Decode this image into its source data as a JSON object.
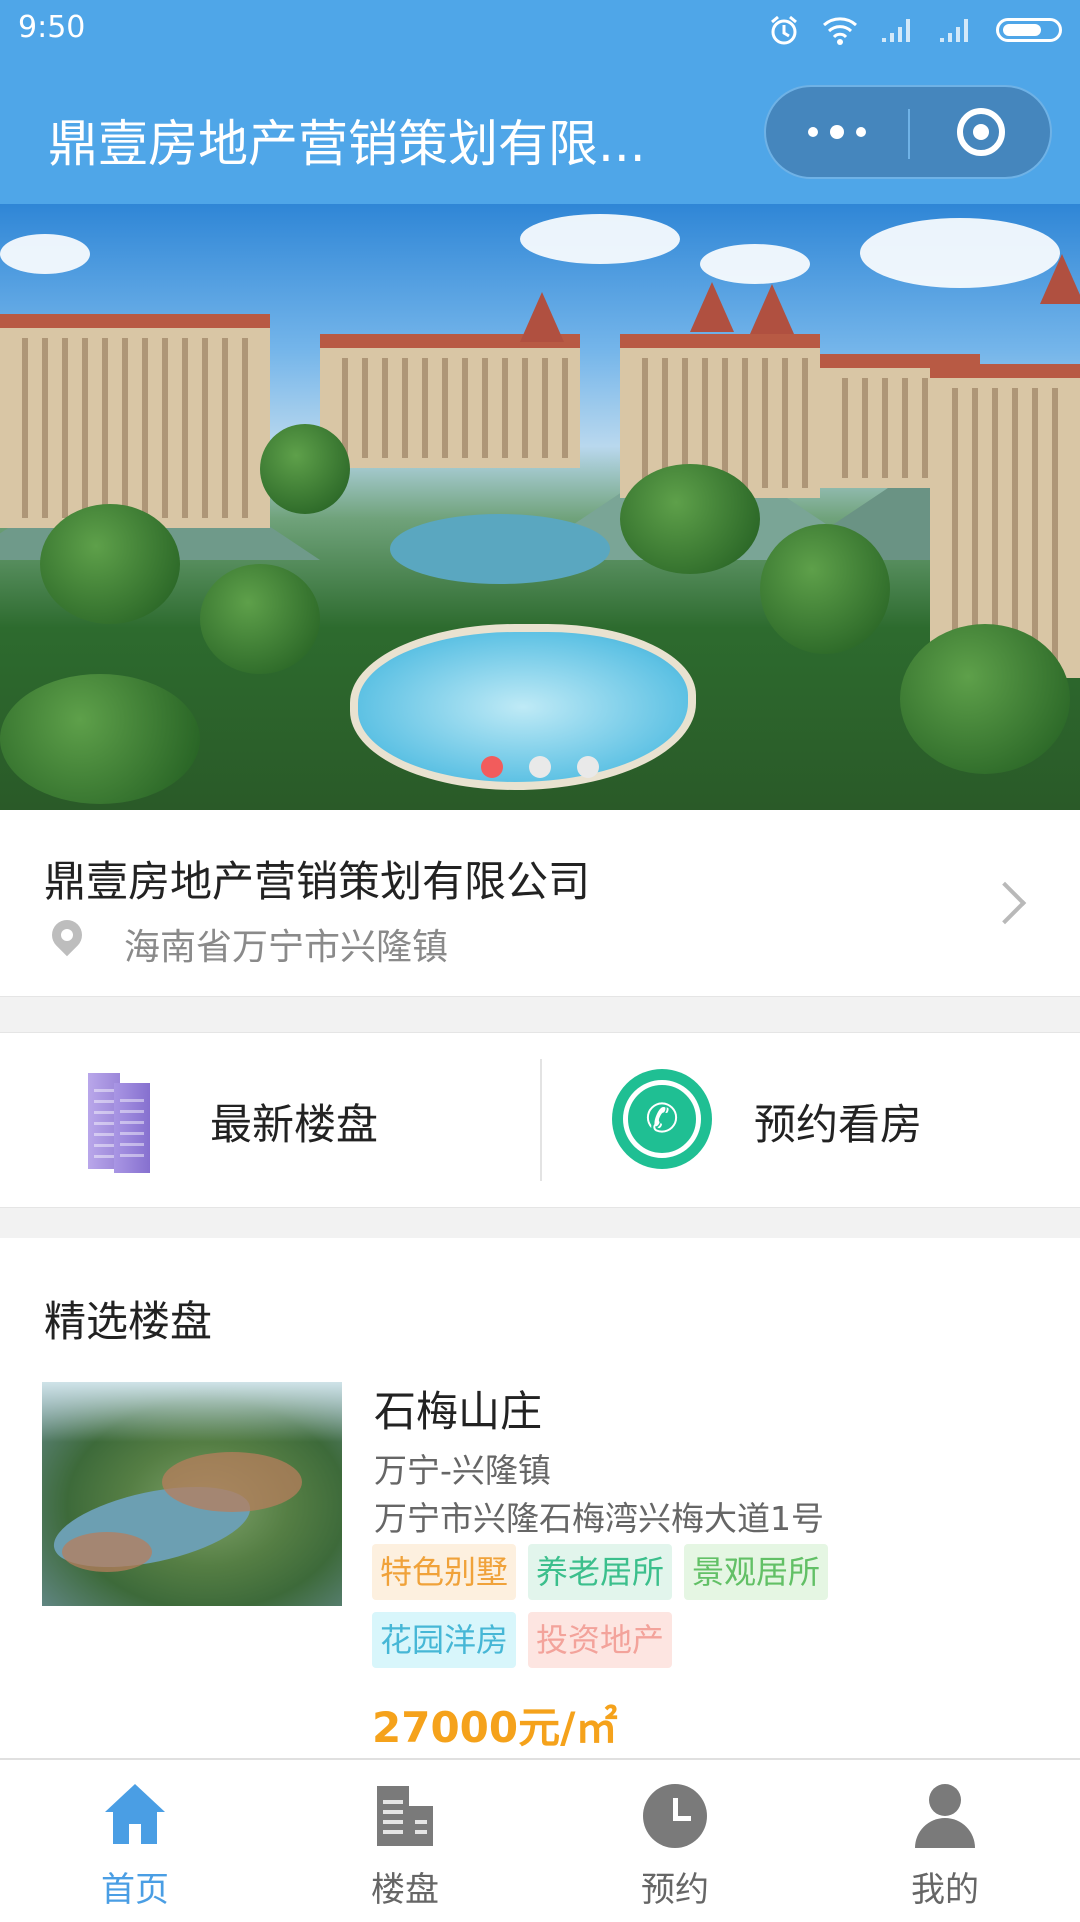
{
  "status_bar": {
    "time": "9:50"
  },
  "app": {
    "title": "鼎壹房地产营销策划有限..."
  },
  "banner": {
    "slide_count": 3,
    "active_slide": 1
  },
  "company": {
    "name": "鼎壹房地产营销策划有限公司",
    "address": "海南省万宁市兴隆镇"
  },
  "entries": [
    {
      "label": "最新楼盘",
      "icon": "buildings-icon"
    },
    {
      "label": "预约看房",
      "icon": "phone-icon"
    }
  ],
  "featured": {
    "title": "精选楼盘",
    "items": [
      {
        "name": "石梅山庄",
        "area": "万宁-兴隆镇",
        "address": "万宁市兴隆石梅湾兴梅大道1号",
        "tags": [
          {
            "text": "特色别墅",
            "fg": "#f0a23a",
            "bg": "#fdf0df"
          },
          {
            "text": "养老居所",
            "fg": "#3bbf8c",
            "bg": "#e2f5ec"
          },
          {
            "text": "景观居所",
            "fg": "#62c066",
            "bg": "#e5f6e3"
          },
          {
            "text": "花园洋房",
            "fg": "#46b7d6",
            "bg": "#d8f6fb"
          },
          {
            "text": "投资地产",
            "fg": "#f3a39b",
            "bg": "#fde5e1"
          }
        ],
        "price": "27000元/㎡"
      }
    ]
  },
  "tabbar": {
    "active_index": 0,
    "active_color": "#4a9ee4",
    "items": [
      {
        "label": "首页",
        "icon": "home-icon"
      },
      {
        "label": "楼盘",
        "icon": "city-icon"
      },
      {
        "label": "预约",
        "icon": "clock-icon"
      },
      {
        "label": "我的",
        "icon": "user-icon"
      }
    ]
  }
}
